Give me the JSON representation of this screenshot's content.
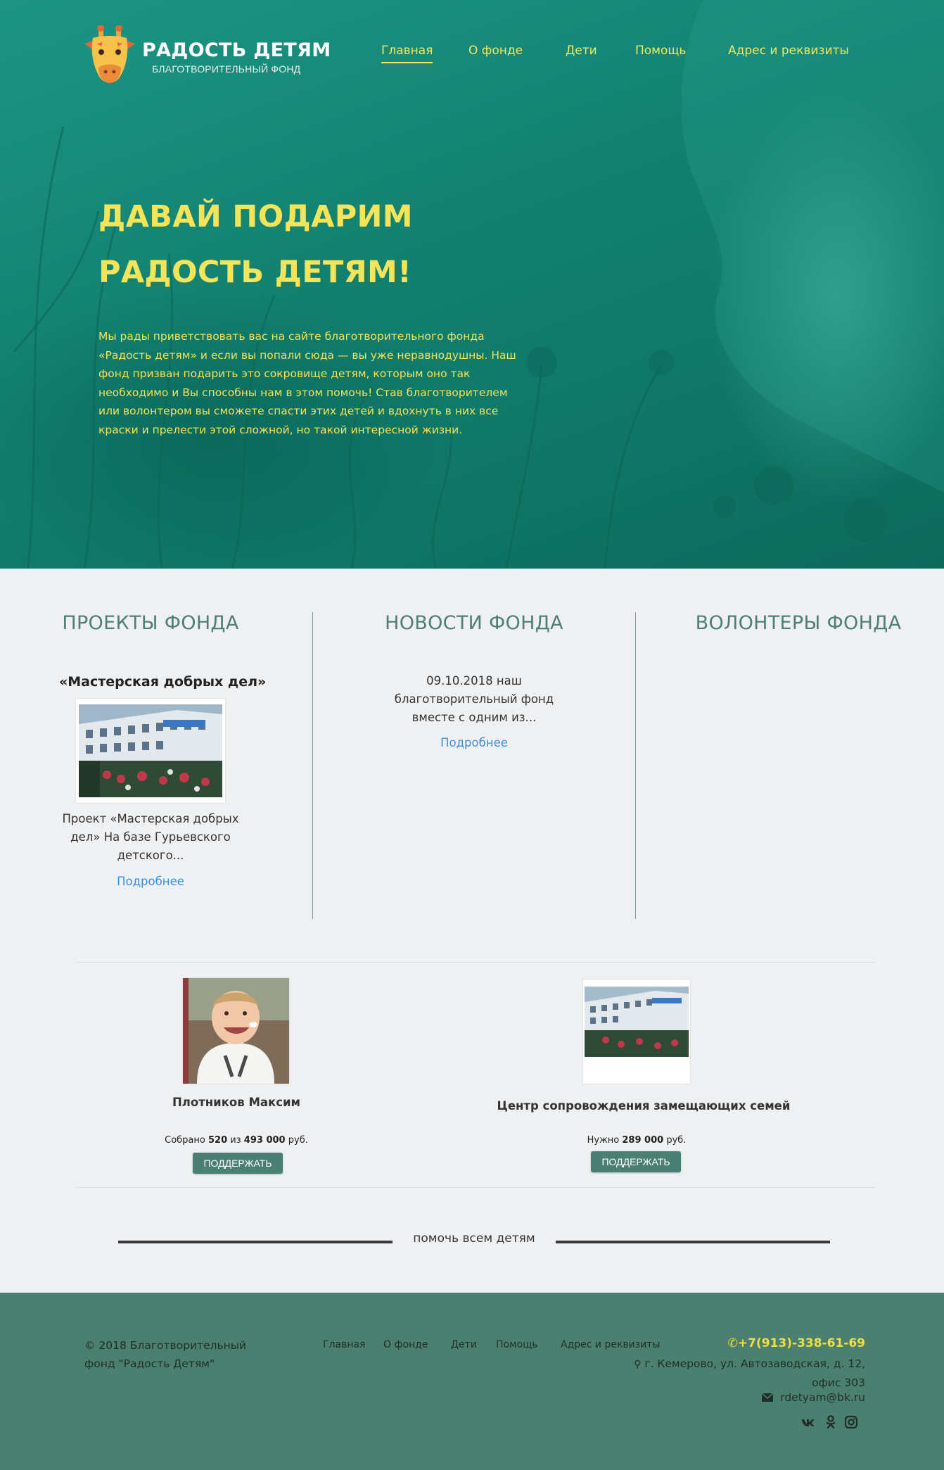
{
  "brand": {
    "title": "РАДОСТЬ ДЕТЯМ",
    "subtitle": "БЛАГОТВОРИТЕЛЬНЫЙ ФОНД",
    "logo_icon": "giraffe-icon"
  },
  "nav": {
    "items": [
      {
        "label": "Главная",
        "active": true
      },
      {
        "label": "О фонде"
      },
      {
        "label": "Дети"
      },
      {
        "label": "Помощь"
      },
      {
        "label": "Адрес и реквизиты"
      }
    ]
  },
  "hero": {
    "line1": "ДАВАЙ ПОДАРИМ",
    "line2": "РАДОСТЬ ДЕТЯМ!",
    "text": "Мы рады приветствовать вас на сайте благотворительного фонда «Радость детям» и если вы попали сюда — вы уже неравнодушны. Наш фонд призван подарить это сокровище детям, которым оно так необходимо и Вы способны нам в этом помочь! Став благотворителем или волонтером вы сможете спасти этих детей и вдохнуть в них все краски и прелести этой сложной, но такой интересной жизни."
  },
  "projects": {
    "heading": "ПРОЕКТЫ ФОНДА",
    "item_title": "«Мастерская добрых дел»",
    "item_desc": "Проект «Мастерская добрых дел» На базе Гурьевского детского...",
    "more": "Подробнее"
  },
  "news": {
    "heading": "НОВОСТИ ФОНДА",
    "item_desc": "09.10.2018 наш благотворительный фонд вместе с одним из...",
    "more": "Подробнее"
  },
  "volunteers": {
    "heading": "ВОЛОНТЕРЫ ФОНДА"
  },
  "cards": [
    {
      "name": "Плотников Максим",
      "collected_prefix": "Собрано",
      "collected": "520",
      "of": "из",
      "goal": "493 000",
      "currency": "руб.",
      "button": "ПОДДЕРЖАТЬ"
    },
    {
      "name": "Центр сопровождения замещающих семей",
      "need_prefix": "Нужно",
      "need": "289 000",
      "currency": "руб.",
      "button": "ПОДДЕРЖАТЬ"
    }
  ],
  "help_all": "помочь всем детям",
  "footer": {
    "copyright": "© 2018 Благотворительный фонд \"Радость Детям\"",
    "nav": [
      "Главная",
      "О фонде",
      "Дети",
      "Помощь",
      "Адрес и реквизиты"
    ],
    "phone": "+7(913)-338-61-69",
    "address": "г. Кемерово, ул. Автозаводская, д. 12, офис 303",
    "email": "rdetyam@bk.ru",
    "social": [
      "vk-icon",
      "odnoklassniki-icon",
      "instagram-icon"
    ]
  },
  "colors": {
    "hero_teal": "#12806f",
    "accent_yellow": "#f4e45a",
    "section_green": "#4e7f73",
    "footer_green": "#4b8070",
    "link_blue": "#3e8ee0"
  }
}
